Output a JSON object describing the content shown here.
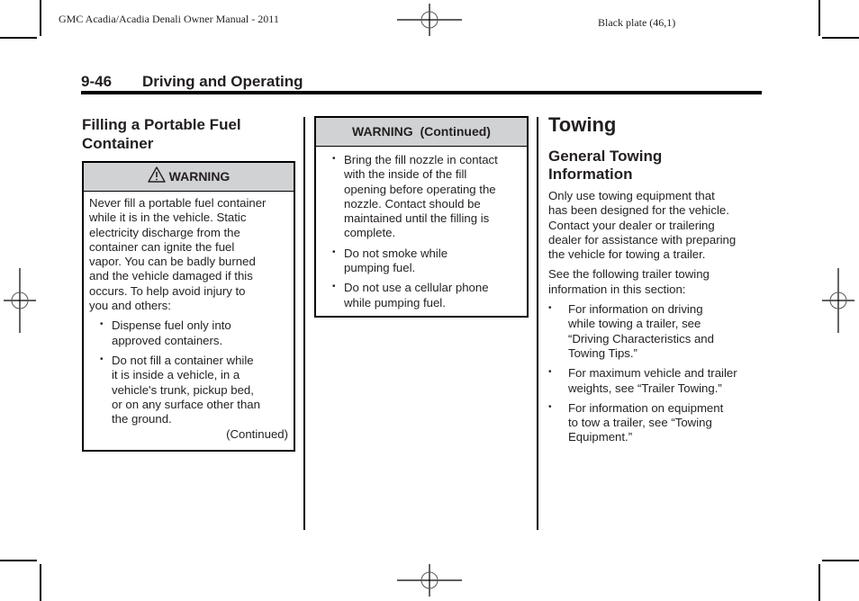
{
  "running_header": {
    "left": "GMC Acadia/Acadia Denali Owner Manual - 2011",
    "right": "Black plate (46,1)"
  },
  "page_header": {
    "page_number": "9-46",
    "section_title": "Driving and Operating"
  },
  "column1": {
    "heading": [
      "Filling a Portable Fuel",
      "Container"
    ],
    "warning": {
      "icon": "warning-triangle-icon",
      "title": "WARNING",
      "text_lines": [
        "Never fill a portable fuel container",
        "while it is in the vehicle. Static",
        "electricity discharge from the",
        "container can ignite the fuel",
        "vapor. You can be badly burned",
        "and the vehicle damaged if this",
        "occurs. To help avoid injury to",
        "you and others:"
      ],
      "bullets": [
        {
          "lines": [
            "Dispense fuel only into",
            "approved containers."
          ]
        },
        {
          "lines": [
            "Do not fill a container while",
            "it is inside a vehicle, in a",
            "vehicle's trunk, pickup bed,",
            "or on any surface other than",
            "the ground."
          ]
        }
      ],
      "continued": "(Continued)"
    }
  },
  "column2": {
    "warning": {
      "title": "WARNING  (Continued)",
      "bullets": [
        {
          "lines": [
            "Bring the fill nozzle in contact",
            "with the inside of the fill",
            "opening before operating the",
            "nozzle. Contact should be",
            "maintained until the filling is",
            "complete."
          ]
        },
        {
          "lines": [
            "Do not smoke while",
            "pumping fuel."
          ]
        },
        {
          "lines": [
            "Do not use a cellular phone",
            "while pumping fuel."
          ]
        }
      ]
    }
  },
  "column3": {
    "title": "Towing",
    "subheading": [
      "General Towing",
      "Information"
    ],
    "paragraph1": [
      "Only use towing equipment that",
      "has been designed for the vehicle.",
      "Contact your dealer or trailering",
      "dealer for assistance with preparing",
      "the vehicle for towing a trailer."
    ],
    "paragraph2": [
      "See the following trailer towing",
      "information in this section:"
    ],
    "bullets": [
      {
        "lines": [
          "For information on driving",
          "while towing a trailer, see",
          "“Driving Characteristics and",
          "Towing Tips.”"
        ]
      },
      {
        "lines": [
          "For maximum vehicle and trailer",
          "weights, see “Trailer Towing.”"
        ]
      },
      {
        "lines": [
          "For information on equipment",
          "to tow a trailer, see “Towing",
          "Equipment.”"
        ]
      }
    ]
  },
  "bullet_glyph": "•"
}
